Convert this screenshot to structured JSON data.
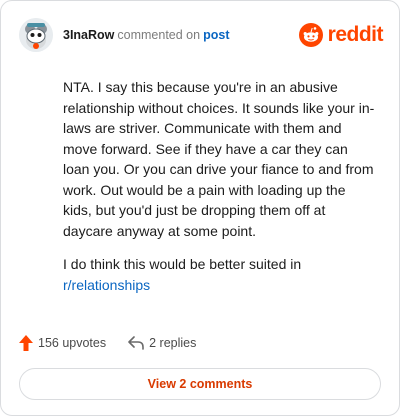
{
  "header": {
    "username": "3InaRow",
    "verb": "commented on",
    "post_link": "post",
    "brand": "reddit"
  },
  "comment": {
    "paragraph1": "NTA. I say this because you're in an abusive relationship without choices. It sounds like your in-laws are striver. Communicate with them and move forward. See if they have a car they can loan you. Or you can drive your fiance to and from work. Out would be a pain with loading up the kids, but you'd just be dropping them off at daycare anyway at some point.",
    "paragraph2_prefix": "I do think this would be better suited in",
    "subreddit_link": "r/relationships"
  },
  "actions": {
    "upvotes": "156 upvotes",
    "replies": "2 replies"
  },
  "footer": {
    "view_comments": "View 2 comments"
  },
  "colors": {
    "brand": "#ff4500",
    "link": "#0a66c2",
    "view_button_text": "#d93a00"
  },
  "icons": {
    "avatar": "snoo-avatar-icon",
    "brand": "reddit-logo-icon",
    "upvote": "upvote-arrow-icon",
    "reply": "reply-arrow-icon"
  }
}
